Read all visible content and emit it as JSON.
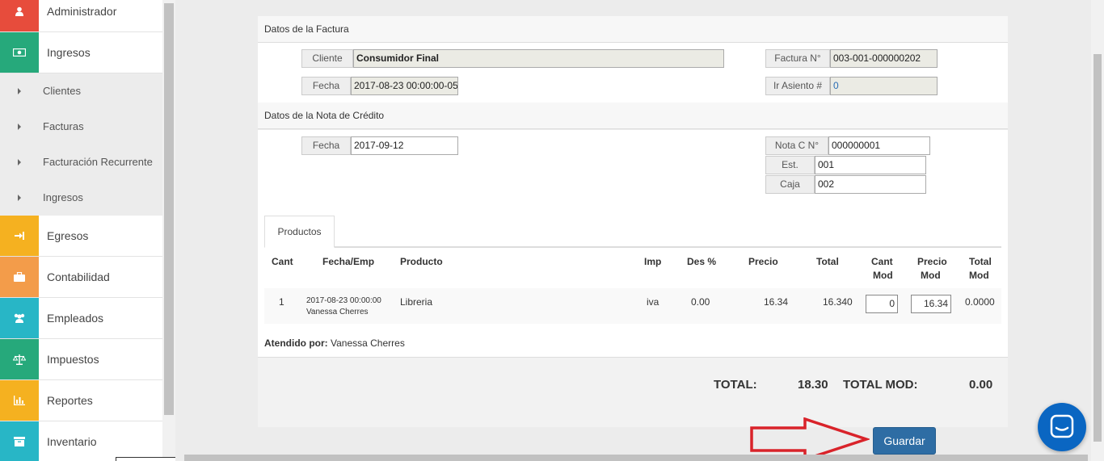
{
  "sidebar": {
    "items": [
      {
        "label": "Administrador",
        "color": "#e74c3c",
        "icon": "user-icon"
      },
      {
        "label": "Ingresos",
        "color": "#26a97b",
        "icon": "money-icon"
      },
      {
        "label": "Egresos",
        "color": "#f5b120",
        "icon": "sign-in-icon"
      },
      {
        "label": "Contabilidad",
        "color": "#f39c4a",
        "icon": "briefcase-icon"
      },
      {
        "label": "Empleados",
        "color": "#28b6c6",
        "icon": "users-icon"
      },
      {
        "label": "Impuestos",
        "color": "#26a97b",
        "icon": "balance-scale-icon"
      },
      {
        "label": "Reportes",
        "color": "#f5b120",
        "icon": "bar-chart-icon"
      },
      {
        "label": "Inventario",
        "color": "#28b6c6",
        "icon": "archive-icon"
      }
    ],
    "subitems": [
      "Clientes",
      "Facturas",
      "Facturación Recurrente",
      "Ingresos"
    ]
  },
  "factura": {
    "section_title": "Datos de la Factura",
    "cliente_label": "Cliente",
    "cliente_value": "Consumidor Final",
    "fecha_label": "Fecha",
    "fecha_value": "2017-08-23 00:00:00-05",
    "factura_label": "Factura N°",
    "factura_value": "003-001-000000202",
    "asiento_label": "Ir Asiento #",
    "asiento_value": "0"
  },
  "nota": {
    "section_title": "Datos de la Nota de Crédito",
    "fecha_label": "Fecha",
    "fecha_value": "2017-09-12",
    "nota_label": "Nota C N°",
    "nota_value": "000000001",
    "est_label": "Est.",
    "est_value": "001",
    "caja_label": "Caja",
    "caja_value": "002"
  },
  "productos": {
    "tab_label": "Productos",
    "headers": {
      "cant": "Cant",
      "fecha_emp": "Fecha/Emp",
      "producto": "Producto",
      "imp": "Imp",
      "des": "Des %",
      "precio": "Precio",
      "total": "Total",
      "cant_mod_1": "Cant",
      "cant_mod_2": "Mod",
      "precio_mod_1": "Precio",
      "precio_mod_2": "Mod",
      "total_mod_1": "Total",
      "total_mod_2": "Mod"
    },
    "row": {
      "cant": "1",
      "fecha": "2017-08-23 00:00:00",
      "empleado": "Vanessa Cherres",
      "producto": "Libreria",
      "imp": "iva",
      "des": "0.00",
      "precio": "16.34",
      "total": "16.340",
      "cant_mod": "0",
      "precio_mod": "16.34",
      "total_mod": "0.0000"
    }
  },
  "atendido": {
    "label": "Atendido por:",
    "value": "Vanessa Cherres"
  },
  "totals": {
    "total_label": "TOTAL:",
    "total_value": "18.30",
    "total_mod_label": "TOTAL MOD:",
    "total_mod_value": "0.00"
  },
  "actions": {
    "guardar_label": "Guardar"
  }
}
